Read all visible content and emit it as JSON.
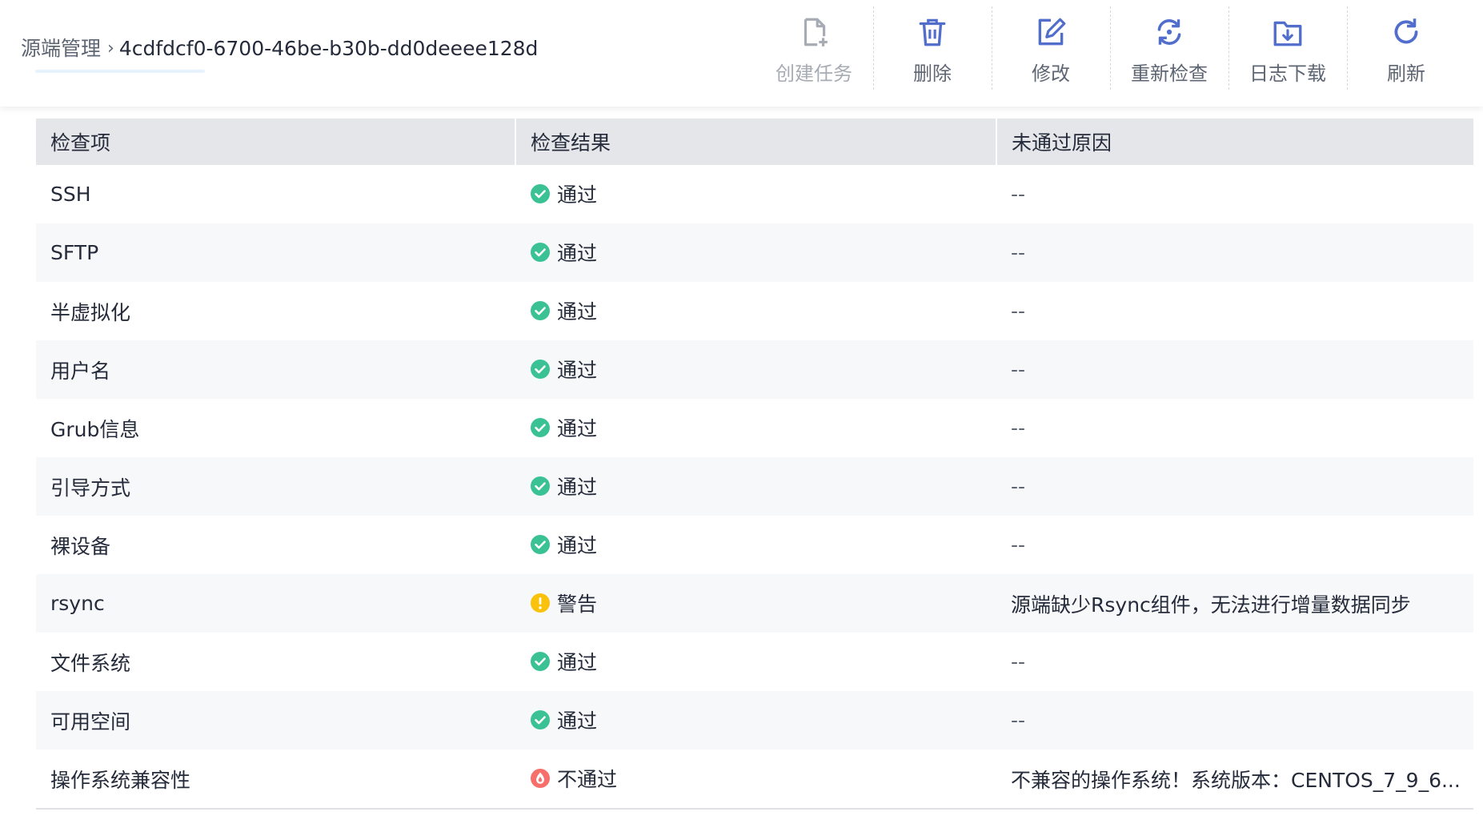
{
  "breadcrumb": {
    "root": "源端管理",
    "separator": "›",
    "current": "4cdfdcf0-6700-46be-b30b-dd0deeee128d"
  },
  "toolbar": [
    {
      "key": "create",
      "label": "创建任务",
      "icon": "create-task-icon",
      "disabled": true
    },
    {
      "key": "delete",
      "label": "删除",
      "icon": "trash-icon",
      "disabled": false
    },
    {
      "key": "edit",
      "label": "修改",
      "icon": "edit-icon",
      "disabled": false
    },
    {
      "key": "recheck",
      "label": "重新检查",
      "icon": "recheck-icon",
      "disabled": false
    },
    {
      "key": "log",
      "label": "日志下载",
      "icon": "log-download-icon",
      "disabled": false
    },
    {
      "key": "refresh",
      "label": "刷新",
      "icon": "refresh-icon",
      "disabled": false
    }
  ],
  "table": {
    "columns": [
      "检查项",
      "检查结果",
      "未通过原因"
    ],
    "rows": [
      {
        "item": "SSH",
        "status": "pass",
        "result": "通过",
        "reason": "--"
      },
      {
        "item": "SFTP",
        "status": "pass",
        "result": "通过",
        "reason": "--"
      },
      {
        "item": "半虚拟化",
        "status": "pass",
        "result": "通过",
        "reason": "--"
      },
      {
        "item": "用户名",
        "status": "pass",
        "result": "通过",
        "reason": "--"
      },
      {
        "item": "Grub信息",
        "status": "pass",
        "result": "通过",
        "reason": "--"
      },
      {
        "item": "引导方式",
        "status": "pass",
        "result": "通过",
        "reason": "--"
      },
      {
        "item": "裸设备",
        "status": "pass",
        "result": "通过",
        "reason": "--"
      },
      {
        "item": "rsync",
        "status": "warn",
        "result": "警告",
        "reason": "源端缺少Rsync组件，无法进行增量数据同步"
      },
      {
        "item": "文件系统",
        "status": "pass",
        "result": "通过",
        "reason": "--"
      },
      {
        "item": "可用空间",
        "status": "pass",
        "result": "通过",
        "reason": "--"
      },
      {
        "item": "操作系统兼容性",
        "status": "fail",
        "result": "不通过",
        "reason": "不兼容的操作系统！系统版本：CENTOS_7_9_6..."
      }
    ]
  },
  "colors": {
    "accent": "#526ecc",
    "pass": "#3ac295",
    "warn": "#fac20a",
    "fail": "#f66f6a",
    "header_bg": "#e4e6e9",
    "stripe_bg": "#f7f8fa"
  }
}
